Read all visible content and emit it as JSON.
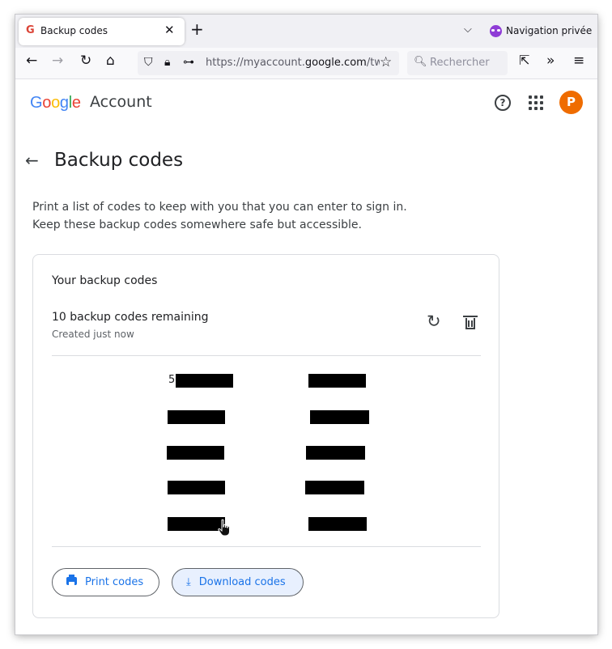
{
  "browser": {
    "tab_title": "Backup codes",
    "tab_favicon": "G",
    "private_label": "Navigation privée",
    "url_prefix": "https://myaccount.",
    "url_domain": "google.com",
    "url_suffix": "/two",
    "search_placeholder": "Rechercher"
  },
  "header": {
    "logo": [
      "G",
      "o",
      "o",
      "g",
      "l",
      "e"
    ],
    "logo_colors": [
      "#4285f4",
      "#ea4335",
      "#fbbc05",
      "#4285f4",
      "#34a853",
      "#ea4335"
    ],
    "account_word": "Account",
    "help_glyph": "?",
    "avatar_letter": "P",
    "avatar_color": "#ef6c00"
  },
  "page": {
    "title": "Backup codes",
    "description": "Print a list of codes to keep with you that you can enter to sign in. Keep these backup codes somewhere safe but accessible."
  },
  "card": {
    "title": "Your backup codes",
    "remaining": "10 backup codes remaining",
    "created": "Created just now",
    "codes": [
      "5",
      "",
      "",
      "",
      "",
      "",
      "",
      "",
      "",
      ""
    ],
    "print_label": "Print codes",
    "download_label": "Download codes"
  },
  "icons": {
    "back": "arrow-left-icon",
    "refresh": "refresh-icon",
    "delete": "trash-icon",
    "print": "printer-icon",
    "download": "download-icon"
  }
}
